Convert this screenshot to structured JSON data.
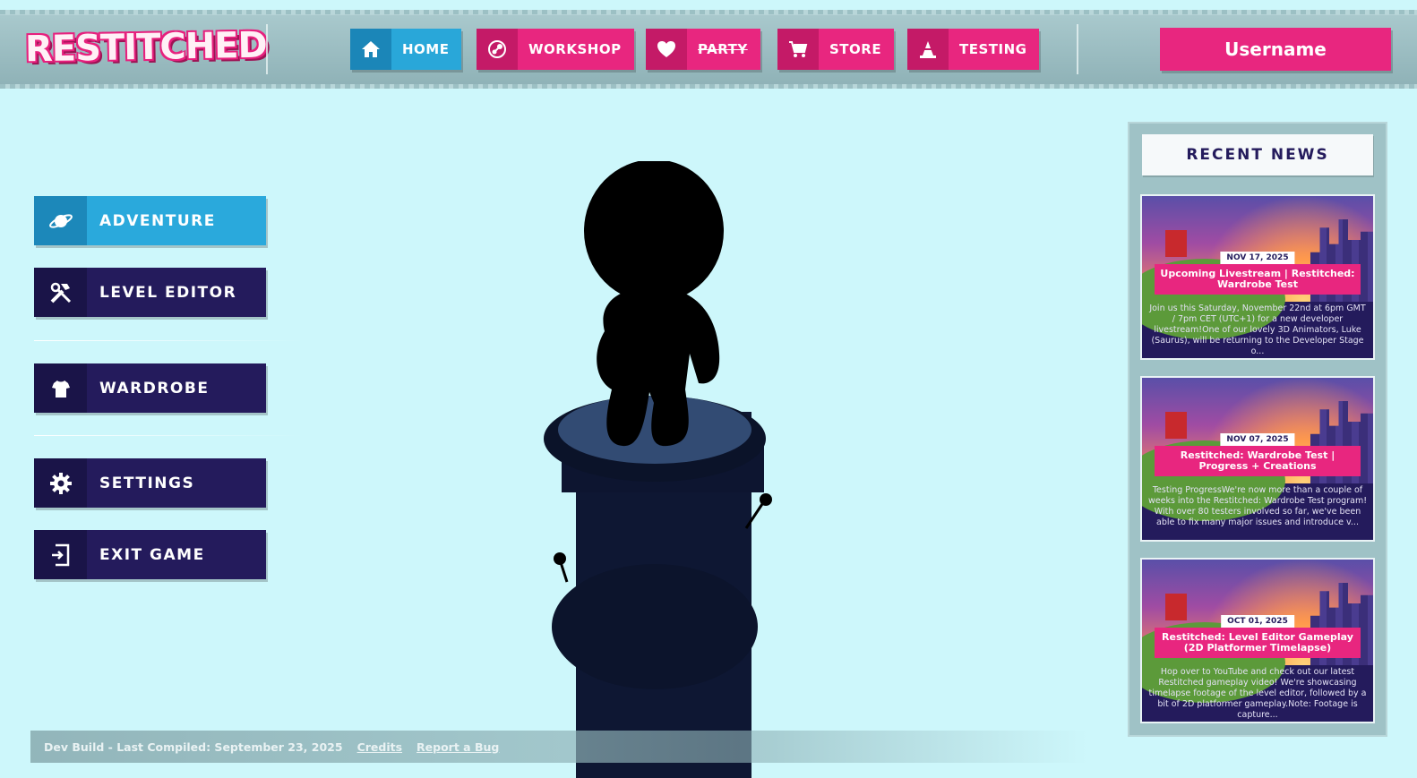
{
  "logo": "RESTITCHED",
  "nav": {
    "home": "HOME",
    "workshop": "WORKSHOP",
    "party": "PARTY",
    "store": "STORE",
    "testing": "TESTING"
  },
  "user": {
    "username": "Username"
  },
  "menu": {
    "adventure": "ADVENTURE",
    "level_editor": "LEVEL EDITOR",
    "wardrobe": "WARDROBE",
    "settings": "SETTINGS",
    "exit_game": "EXIT GAME"
  },
  "news": {
    "heading": "RECENT NEWS",
    "items": [
      {
        "date": "NOV 17, 2025",
        "title": "Upcoming Livestream | Restitched: Wardrobe Test",
        "body": "Join us this Saturday, November 22nd at 6pm GMT / 7pm CET (UTC+1) for a new developer livestream!One of our lovely 3D Animators, Luke (Saurus), will be returning to the Developer Stage o..."
      },
      {
        "date": "NOV 07, 2025",
        "title": "Restitched: Wardrobe Test | Progress + Creations",
        "body": "Testing ProgressWe're now more than a couple of weeks into the Restitched: Wardrobe Test program! With over 80 testers involved so far, we've been able to fix many major issues and introduce v..."
      },
      {
        "date": "OCT 01, 2025",
        "title": "Restitched: Level Editor Gameplay (2D Platformer Timelapse)",
        "body": "Hop over to YouTube and check out our latest Restitched gameplay video! We're showcasing timelapse footage of the level editor, followed by a bit of 2D platformer gameplay.Note: Footage is capture..."
      }
    ]
  },
  "footer": {
    "build": "Dev Build - Last Compiled: September 23, 2025",
    "credits": "Credits",
    "report": "Report a Bug"
  },
  "colors": {
    "background": "#cdf7fb",
    "pink": "#e8267f",
    "blue": "#29a7d9",
    "navy": "#241b5c"
  },
  "icons": {
    "home": "home-icon",
    "workshop": "steam-icon",
    "party": "heart-icon",
    "store": "cart-icon",
    "testing": "cone-icon",
    "adventure": "planet-icon",
    "level_editor": "tools-icon",
    "wardrobe": "shirt-icon",
    "settings": "gear-icon",
    "exit_game": "exit-icon"
  }
}
